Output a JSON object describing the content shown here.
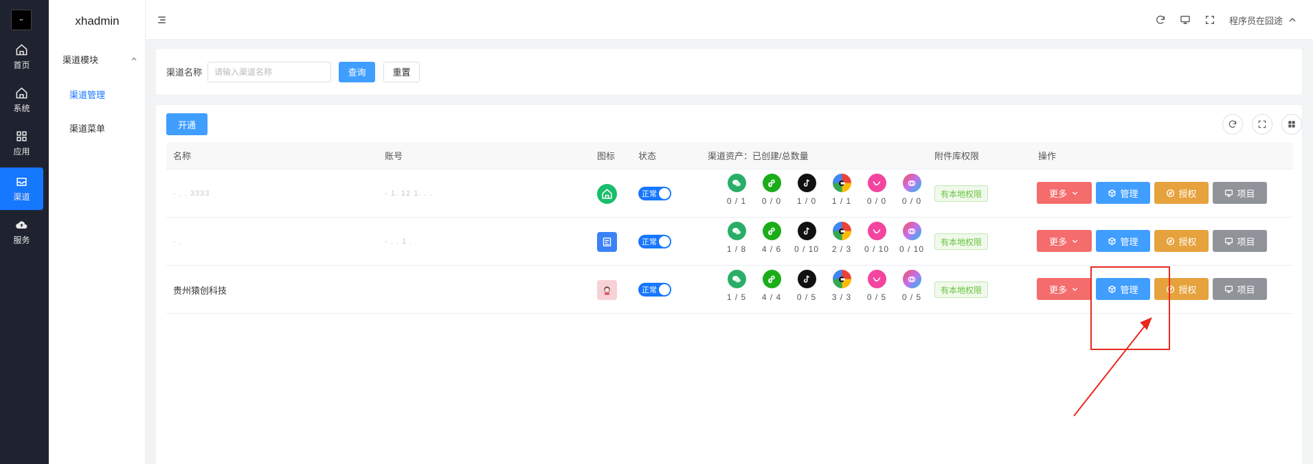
{
  "rail": {
    "items": [
      {
        "label": "首页",
        "icon": "home-icon"
      },
      {
        "label": "系统",
        "icon": "home-outline-icon"
      },
      {
        "label": "应用",
        "icon": "grid-icon"
      },
      {
        "label": "渠道",
        "icon": "inbox-icon",
        "active": true
      },
      {
        "label": "服务",
        "icon": "cloud-upload-icon"
      }
    ]
  },
  "submenu": {
    "title": "xhadmin",
    "group": "渠道模块",
    "links": [
      {
        "label": "渠道管理",
        "active": true
      },
      {
        "label": "渠道菜单",
        "active": false
      }
    ]
  },
  "header": {
    "user": "程序员在囧途"
  },
  "search": {
    "label": "渠道名称",
    "placeholder": "请输入渠道名称",
    "query_label": "查询",
    "reset_label": "重置"
  },
  "table": {
    "open_label": "开通",
    "columns": {
      "name": "名称",
      "account": "账号",
      "icon": "图标",
      "status": "状态",
      "assets": "渠道资产：已创建/总数量",
      "attach": "附件库权限",
      "ops": "操作"
    },
    "rows": [
      {
        "name": "- . . 3333",
        "account": "- 1. 12 1. . .",
        "icon": "house-icon",
        "icon_color": "#19be6b",
        "status": "正常",
        "assets": [
          "0 / 1",
          "0 / 0",
          "1 / 0",
          "1 / 1",
          "0 / 0",
          "0 / 0"
        ],
        "attach": "有本地权限"
      },
      {
        "name": "- .",
        "account": "- . . 1 .",
        "icon": "document-icon",
        "icon_color": "#3b82f6",
        "status": "正常",
        "assets": [
          "1 / 8",
          "4 / 6",
          "0 / 10",
          "2 / 3",
          "0 / 10",
          "0 / 10"
        ],
        "attach": "有本地权限"
      },
      {
        "name": "贵州猿创科技",
        "account": "",
        "icon": "avatar-icon",
        "icon_color": "#f7d1d8",
        "status": "正常",
        "assets": [
          "1 / 5",
          "4 / 4",
          "0 / 5",
          "3 / 3",
          "0 / 5",
          "0 / 5"
        ],
        "attach": "有本地权限"
      }
    ],
    "ops": {
      "more": "更多",
      "manage": "管理",
      "auth": "授权",
      "project": "项目"
    }
  },
  "colors": {
    "primary": "#409eff",
    "danger": "#f56c6c",
    "warning": "#e6a23c",
    "info": "#909399",
    "annotation": "#e8271e"
  }
}
